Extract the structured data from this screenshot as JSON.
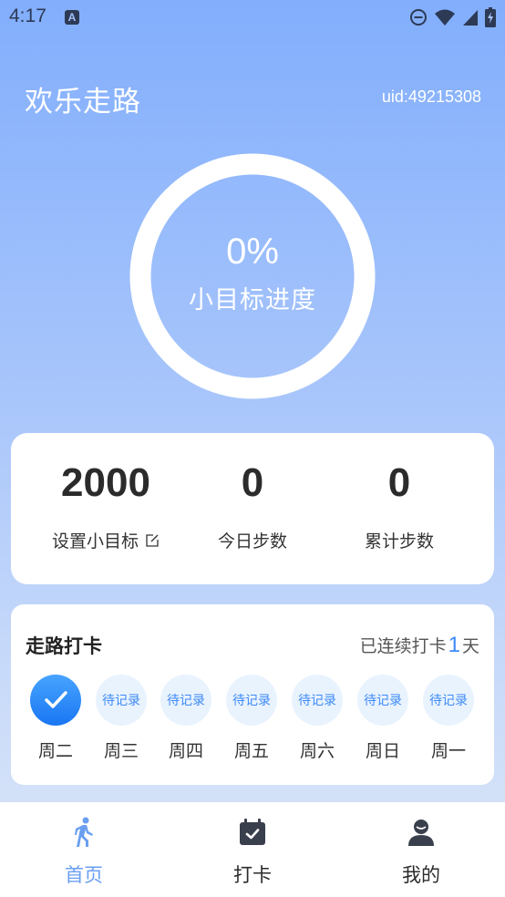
{
  "status_bar": {
    "time": "4:17",
    "notification_letter": "A"
  },
  "header": {
    "app_title": "欢乐走路",
    "uid": "uid:49215308"
  },
  "progress": {
    "percent_text": "0%",
    "label": "小目标进度",
    "value": 0
  },
  "stats": [
    {
      "value": "2000",
      "label": "设置小目标",
      "editable": true
    },
    {
      "value": "0",
      "label": "今日步数"
    },
    {
      "value": "0",
      "label": "累计步数"
    }
  ],
  "checkin": {
    "title": "走路打卡",
    "streak_prefix": "已连续打卡",
    "streak_count": "1",
    "streak_suffix": "天",
    "days": [
      {
        "label": "周二",
        "status": "done",
        "text": ""
      },
      {
        "label": "周三",
        "status": "pending",
        "text": "待记录"
      },
      {
        "label": "周四",
        "status": "pending",
        "text": "待记录"
      },
      {
        "label": "周五",
        "status": "pending",
        "text": "待记录"
      },
      {
        "label": "周六",
        "status": "pending",
        "text": "待记录"
      },
      {
        "label": "周日",
        "status": "pending",
        "text": "待记录"
      },
      {
        "label": "周一",
        "status": "pending",
        "text": "待记录"
      }
    ]
  },
  "nav": [
    {
      "label": "首页",
      "icon": "walking-icon",
      "active": true
    },
    {
      "label": "打卡",
      "icon": "calendar-check-icon",
      "active": false
    },
    {
      "label": "我的",
      "icon": "user-icon",
      "active": false
    }
  ],
  "colors": {
    "accent": "#3d8af7",
    "nav_active": "#6a9ff2",
    "bg_top": "#82aefc"
  }
}
